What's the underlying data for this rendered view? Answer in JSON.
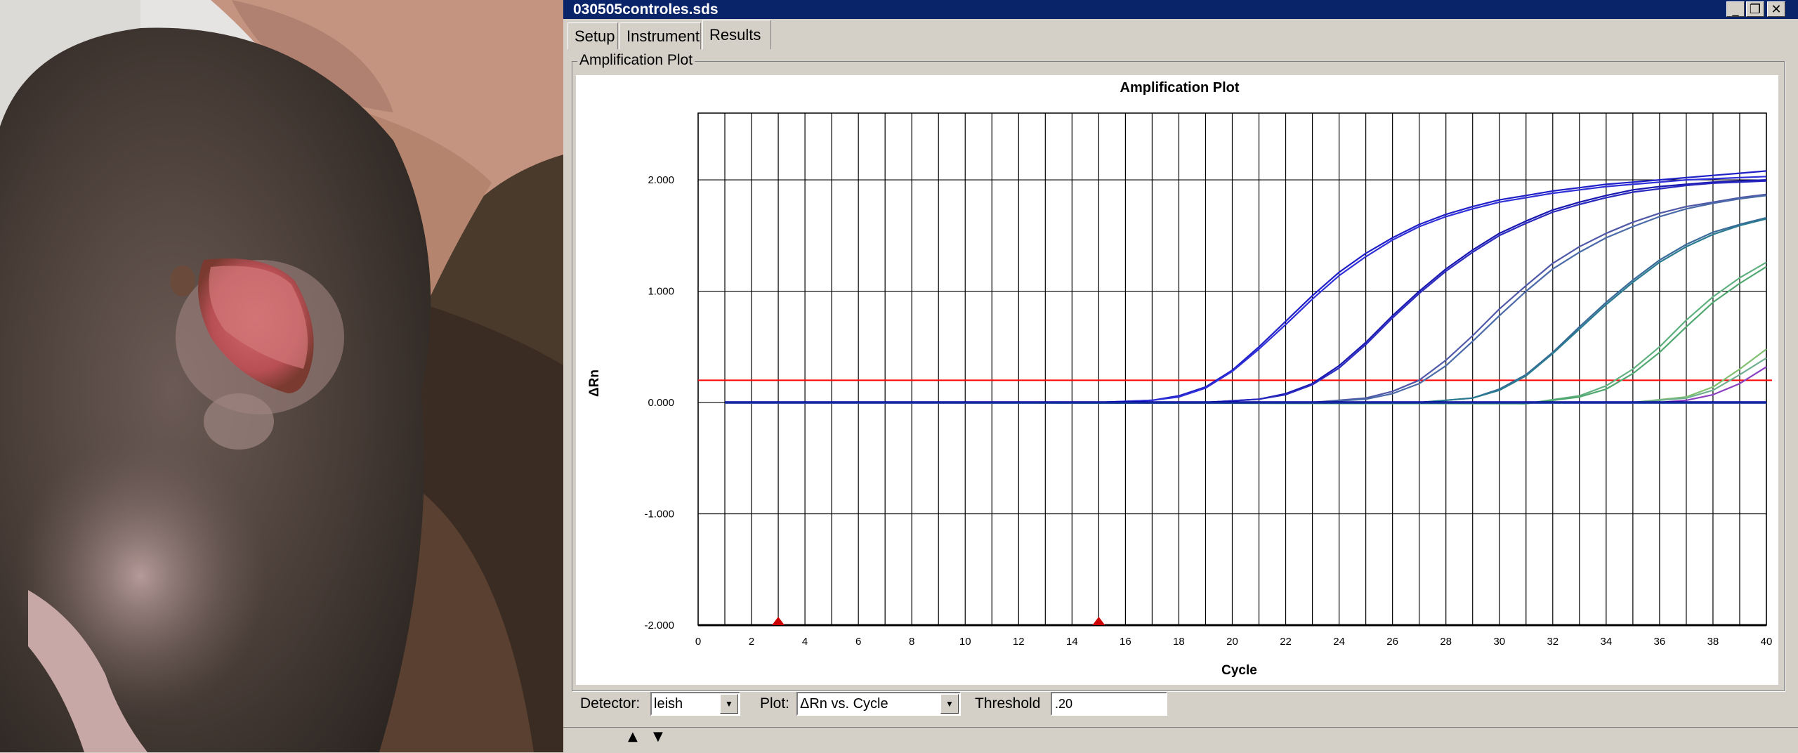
{
  "window": {
    "title": "030505controles.sds",
    "minimize_glyph": "_",
    "restore_glyph": "❐",
    "close_glyph": "✕"
  },
  "tabs": [
    {
      "label": "Setup",
      "active": false
    },
    {
      "label": "Instrument",
      "active": false
    },
    {
      "label": "Results",
      "active": true
    }
  ],
  "group_label": "Amplification Plot",
  "controls": {
    "detector_label": "Detector:",
    "detector_value": "leish",
    "plot_label": "Plot:",
    "plot_value": "ΔRn vs. Cycle",
    "threshold_label": "Threshold",
    "threshold_value": ".20"
  },
  "colors": {
    "threshold_line": "#ff0000",
    "titlebar": "#0a246a",
    "window_bg": "#d4d0c8"
  },
  "chart_data": {
    "type": "line",
    "title": "Amplification Plot",
    "xlabel": "Cycle",
    "ylabel": "ΔRn",
    "xlim": [
      0,
      40
    ],
    "ylim": [
      -2,
      2.6
    ],
    "x_ticks": [
      0,
      2,
      4,
      6,
      8,
      10,
      12,
      14,
      16,
      18,
      20,
      22,
      24,
      26,
      28,
      30,
      32,
      34,
      36,
      38,
      40
    ],
    "y_ticks": [
      -2,
      -1,
      0,
      1,
      2
    ],
    "y_tick_labels": [
      "-2.000",
      "-1.000",
      "0.000",
      "1.000",
      "2.000"
    ],
    "grid": true,
    "threshold": 0.2,
    "baseline_markers": [
      3,
      15
    ],
    "series": [
      {
        "color": "#2020c8",
        "x": [
          1,
          15,
          17,
          18,
          19,
          20,
          21,
          22,
          23,
          24,
          25,
          26,
          27,
          28,
          29,
          30,
          31,
          32,
          33,
          34,
          35,
          36,
          37,
          38,
          39,
          40
        ],
        "values": [
          0,
          0,
          0.02,
          0.06,
          0.14,
          0.29,
          0.5,
          0.73,
          0.96,
          1.17,
          1.34,
          1.48,
          1.6,
          1.69,
          1.76,
          1.82,
          1.86,
          1.9,
          1.93,
          1.96,
          1.98,
          2.0,
          2.02,
          2.04,
          2.06,
          2.08
        ]
      },
      {
        "color": "#3030d8",
        "x": [
          1,
          15,
          17,
          18,
          19,
          20,
          21,
          22,
          23,
          24,
          25,
          26,
          27,
          28,
          29,
          30,
          31,
          32,
          33,
          34,
          35,
          36,
          37,
          38,
          39,
          40
        ],
        "values": [
          0,
          0,
          0.02,
          0.05,
          0.13,
          0.28,
          0.48,
          0.7,
          0.93,
          1.14,
          1.31,
          1.46,
          1.58,
          1.67,
          1.74,
          1.8,
          1.84,
          1.88,
          1.91,
          1.94,
          1.96,
          1.98,
          2.0,
          2.01,
          2.02,
          2.03
        ]
      },
      {
        "color": "#1818b0",
        "x": [
          1,
          19,
          21,
          22,
          23,
          24,
          25,
          26,
          27,
          28,
          29,
          30,
          31,
          32,
          33,
          34,
          35,
          36,
          37,
          38,
          39,
          40
        ],
        "values": [
          0,
          0,
          0.03,
          0.08,
          0.17,
          0.33,
          0.54,
          0.78,
          1.0,
          1.2,
          1.37,
          1.52,
          1.63,
          1.73,
          1.8,
          1.86,
          1.91,
          1.94,
          1.96,
          1.98,
          1.99,
          2.0
        ]
      },
      {
        "color": "#2a2ac0",
        "x": [
          1,
          19,
          21,
          22,
          23,
          24,
          25,
          26,
          27,
          28,
          29,
          30,
          31,
          32,
          33,
          34,
          35,
          36,
          37,
          38,
          39,
          40
        ],
        "values": [
          0,
          0,
          0.03,
          0.07,
          0.16,
          0.31,
          0.52,
          0.76,
          0.98,
          1.18,
          1.35,
          1.5,
          1.61,
          1.71,
          1.78,
          1.84,
          1.89,
          1.92,
          1.95,
          1.97,
          1.98,
          1.99
        ]
      },
      {
        "color": "#5058a8",
        "x": [
          1,
          23,
          25,
          26,
          27,
          28,
          29,
          30,
          31,
          32,
          33,
          34,
          35,
          36,
          37,
          38,
          39,
          40
        ],
        "values": [
          0,
          0,
          0.04,
          0.1,
          0.2,
          0.38,
          0.6,
          0.84,
          1.05,
          1.25,
          1.4,
          1.52,
          1.62,
          1.7,
          1.76,
          1.8,
          1.84,
          1.87
        ]
      },
      {
        "color": "#4a6aa8",
        "x": [
          1,
          23,
          25,
          26,
          27,
          28,
          29,
          30,
          31,
          32,
          33,
          34,
          35,
          36,
          37,
          38,
          39,
          40
        ],
        "values": [
          0,
          0,
          0.03,
          0.08,
          0.17,
          0.33,
          0.55,
          0.78,
          1.0,
          1.2,
          1.35,
          1.48,
          1.58,
          1.67,
          1.74,
          1.79,
          1.83,
          1.86
        ]
      },
      {
        "color": "#3a6a9a",
        "x": [
          1,
          27,
          29,
          30,
          31,
          32,
          33,
          34,
          35,
          36,
          37,
          38,
          39,
          40
        ],
        "values": [
          0,
          0,
          0.04,
          0.12,
          0.25,
          0.45,
          0.68,
          0.9,
          1.1,
          1.28,
          1.42,
          1.53,
          1.6,
          1.66
        ]
      },
      {
        "color": "#2a7a90",
        "x": [
          1,
          27,
          29,
          30,
          31,
          32,
          33,
          34,
          35,
          36,
          37,
          38,
          39,
          40
        ],
        "values": [
          0,
          0,
          0.04,
          0.11,
          0.24,
          0.44,
          0.66,
          0.88,
          1.08,
          1.26,
          1.4,
          1.51,
          1.59,
          1.65
        ]
      },
      {
        "color": "#60b080",
        "x": [
          1,
          31,
          33,
          34,
          35,
          36,
          37,
          38,
          39,
          40
        ],
        "values": [
          0,
          -0.01,
          0.06,
          0.15,
          0.3,
          0.5,
          0.74,
          0.95,
          1.12,
          1.26
        ]
      },
      {
        "color": "#50a870",
        "x": [
          1,
          31,
          33,
          34,
          35,
          36,
          37,
          38,
          39,
          40
        ],
        "values": [
          0,
          -0.01,
          0.05,
          0.12,
          0.26,
          0.45,
          0.68,
          0.9,
          1.07,
          1.22
        ]
      },
      {
        "color": "#80c070",
        "x": [
          1,
          35,
          37,
          38,
          39,
          40
        ],
        "values": [
          0,
          0,
          0.05,
          0.14,
          0.3,
          0.48
        ]
      },
      {
        "color": "#70b090",
        "x": [
          1,
          35,
          37,
          38,
          39,
          40
        ],
        "values": [
          0,
          0,
          0.04,
          0.11,
          0.25,
          0.4
        ]
      },
      {
        "color": "#8a40c0",
        "x": [
          1,
          36,
          37,
          38,
          39,
          40
        ],
        "values": [
          0,
          0,
          0.02,
          0.07,
          0.17,
          0.32
        ]
      },
      {
        "color": "#0000a0",
        "x": [
          1,
          40
        ],
        "values": [
          0.005,
          0.005
        ]
      },
      {
        "color": "#2040a0",
        "x": [
          1,
          40
        ],
        "values": [
          -0.005,
          -0.005
        ]
      }
    ]
  }
}
